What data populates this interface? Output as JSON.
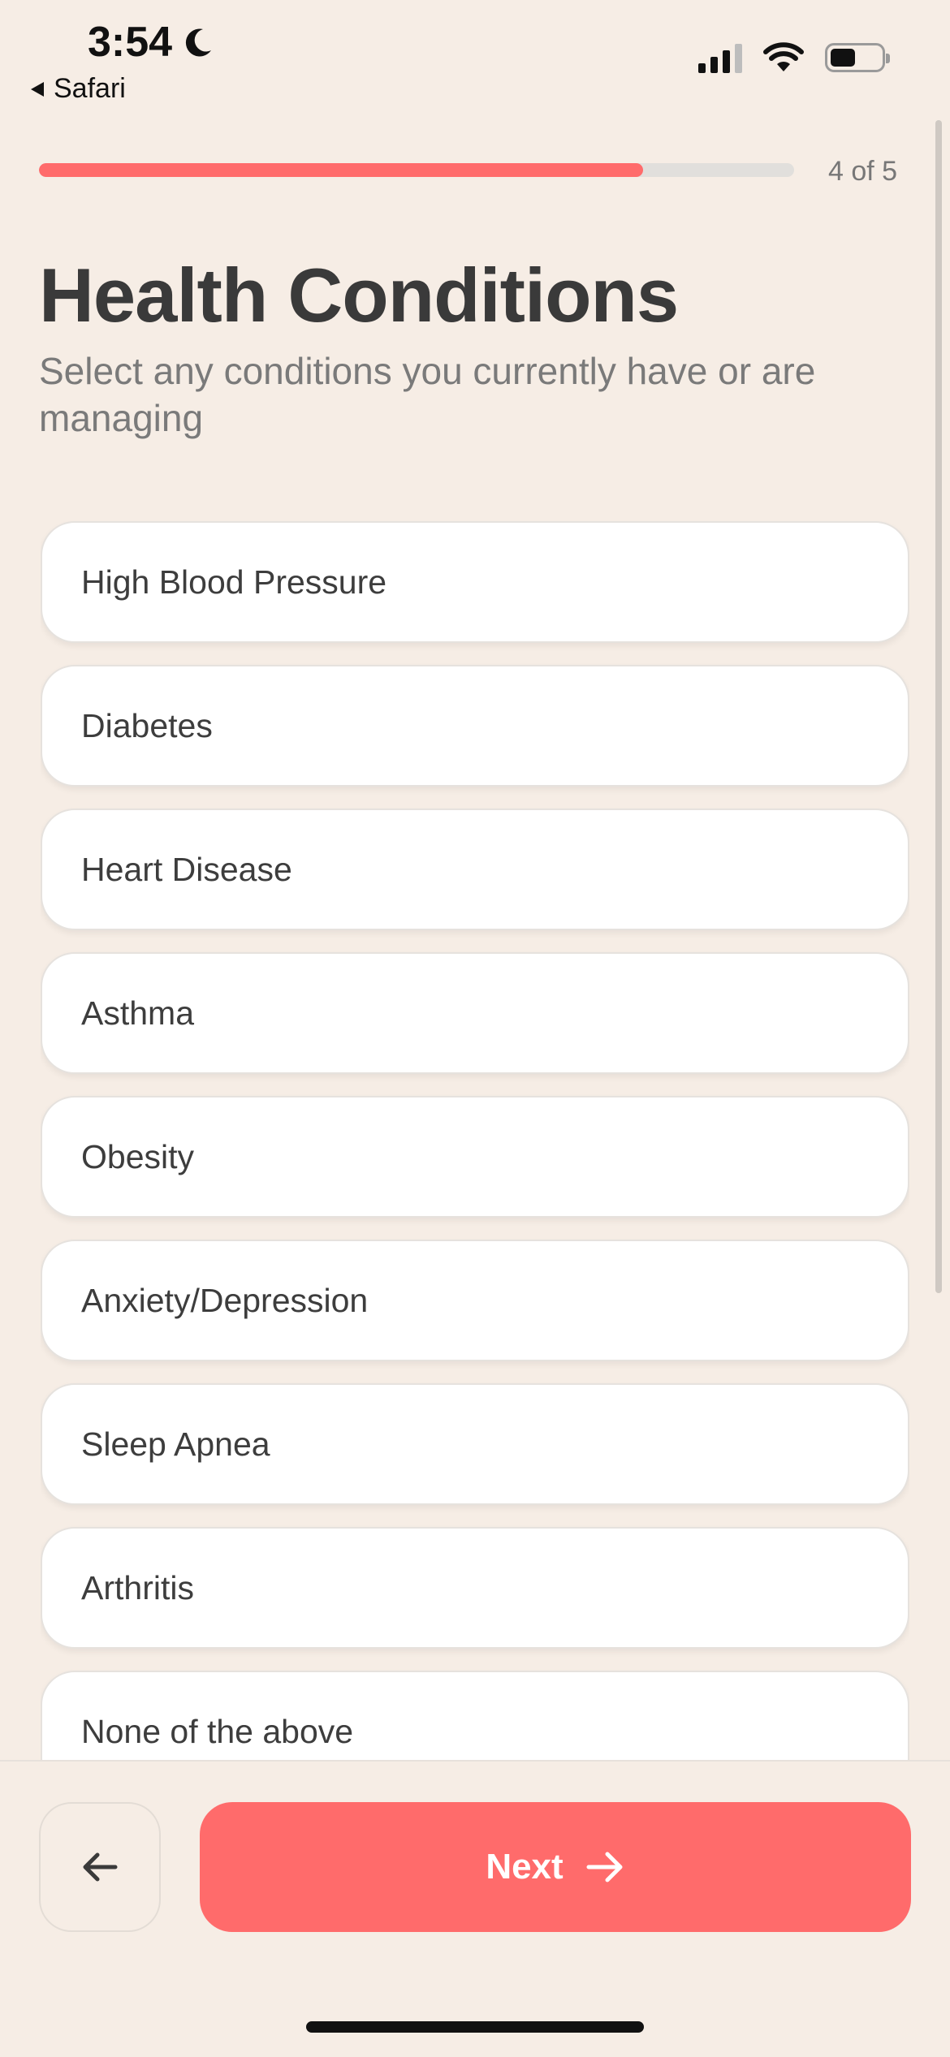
{
  "status_bar": {
    "time": "3:54",
    "back_app": "Safari",
    "moon_icon": "moon-icon",
    "signal_icon": "cellular-signal-icon",
    "wifi_icon": "wifi-icon",
    "battery_icon": "battery-icon",
    "battery_level": 0.5
  },
  "progress": {
    "label": "4 of 5",
    "fraction": 0.8,
    "color": "#ff6b6b"
  },
  "header": {
    "title": "Health Conditions",
    "subtitle": "Select any conditions you currently have or are managing"
  },
  "options": [
    {
      "label": "High Blood Pressure"
    },
    {
      "label": "Diabetes"
    },
    {
      "label": "Heart Disease"
    },
    {
      "label": "Asthma"
    },
    {
      "label": "Obesity"
    },
    {
      "label": "Anxiety/Depression"
    },
    {
      "label": "Sleep Apnea"
    },
    {
      "label": "Arthritis"
    },
    {
      "label": "None of the above"
    }
  ],
  "footer": {
    "back_icon": "arrow-left-icon",
    "next_label": "Next",
    "next_icon": "arrow-right-icon"
  },
  "colors": {
    "background": "#f6ede5",
    "accent": "#ff6b6b"
  }
}
